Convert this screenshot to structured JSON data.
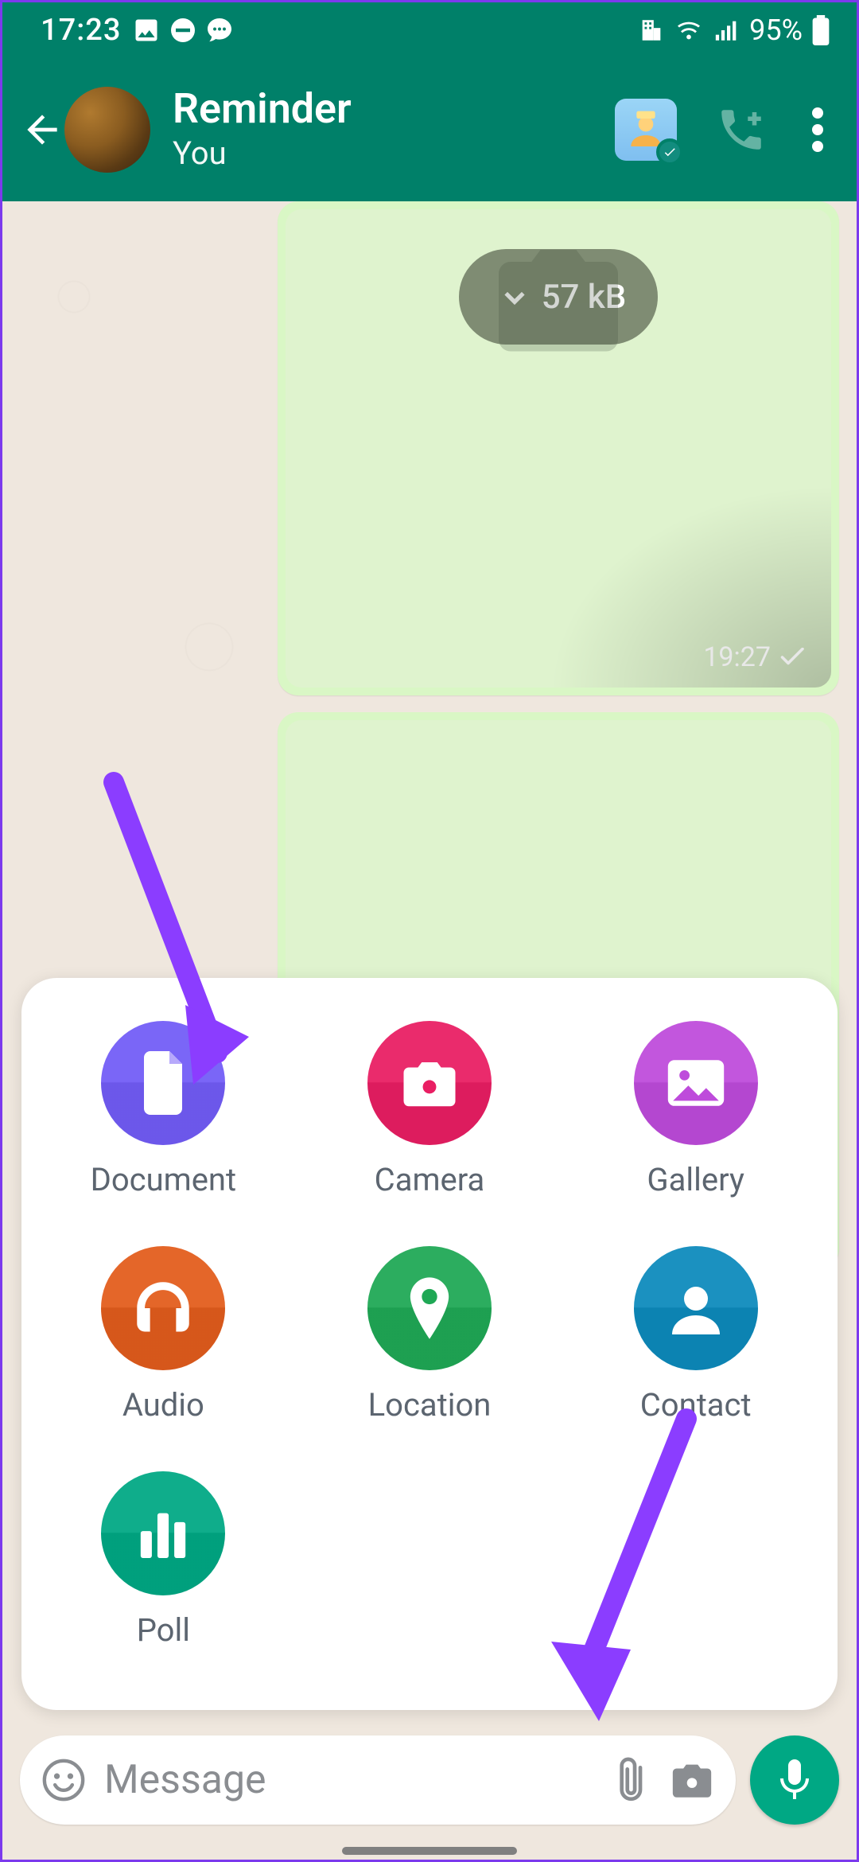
{
  "status": {
    "time": "17:23",
    "battery_pct": "95%"
  },
  "chat": {
    "title": "Reminder",
    "subtitle": "You"
  },
  "messages": {
    "m1": {
      "download_size": "57 kB",
      "time": "19:27"
    }
  },
  "attach_sheet": {
    "document": "Document",
    "camera": "Camera",
    "gallery": "Gallery",
    "audio": "Audio",
    "location": "Location",
    "contact": "Contact",
    "poll": "Poll"
  },
  "input": {
    "placeholder": "Message"
  }
}
